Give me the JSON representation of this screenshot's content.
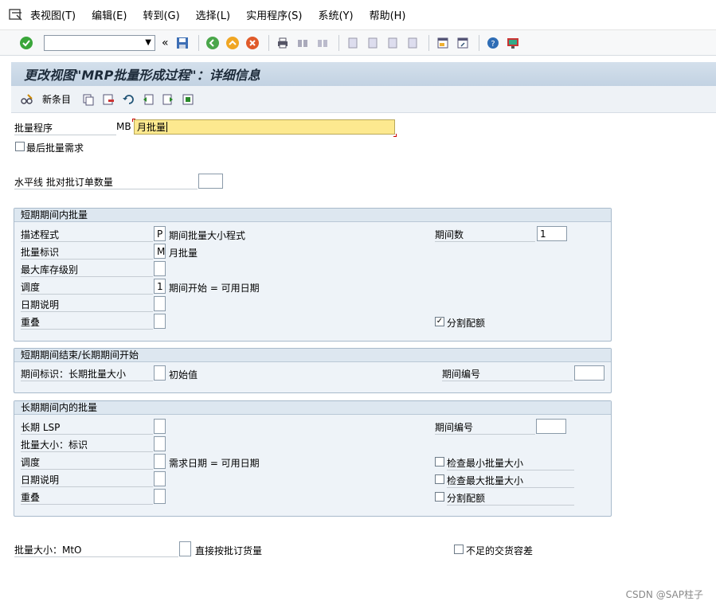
{
  "menubar": {
    "items": [
      "表视图(T)",
      "编辑(E)",
      "转到(G)",
      "选择(L)",
      "实用程序(S)",
      "系统(Y)",
      "帮助(H)"
    ]
  },
  "toolbar": {
    "cmd_chevron": "«"
  },
  "title": "更改视图\"MRP批量形成过程\"：详细信息",
  "apptoolbar": {
    "new_entry": "新条目"
  },
  "header": {
    "lot_proc_label": "批量程序",
    "lot_proc_code": "MB",
    "lot_proc_value": "月批量",
    "last_lot_label": "最后批量需求",
    "horizon_label": "水平线 批对批订单数量",
    "horizon_value": ""
  },
  "short_group": {
    "title": "短期期间内批量",
    "desc_label": "描述程式",
    "desc_code": "P",
    "desc_text": "期间批量大小程式",
    "periods_label": "期间数",
    "periods_value": "1",
    "lot_ind_label": "批量标识",
    "lot_ind_code": "M",
    "lot_ind_text": "月批量",
    "max_stock_label": "最大库存级别",
    "schedule_label": "调度",
    "schedule_code": "1",
    "schedule_text": "期间开始 = 可用日期",
    "date_spec_label": "日期说明",
    "overlap_label": "重叠",
    "split_quota_label": "分割配额"
  },
  "mid_group": {
    "title": "短期期间结束/长期期间开始",
    "period_ind_label": "期间标识：长期批量大小",
    "period_ind_text": "初始值",
    "period_num_label": "期间编号"
  },
  "long_group": {
    "title": "长期期间内的批量",
    "lsp_label": "长期 LSP",
    "period_num_label": "期间编号",
    "lot_size_label": "批量大小：标识",
    "schedule_label": "调度",
    "schedule_text": "需求日期 = 可用日期",
    "check_min_label": "检查最小批量大小",
    "date_spec_label": "日期说明",
    "check_max_label": "检查最大批量大小",
    "overlap_label": "重叠",
    "split_quota_label": "分割配额"
  },
  "bottom": {
    "mto_label": "批量大小：MtO",
    "direct_label": "直接按批订货量",
    "short_delivery_label": "不足的交货容差"
  },
  "watermark": "CSDN @SAP柱子",
  "colors": {
    "title_bg": "#c8d7e6",
    "group_bg": "#eef3f8",
    "highlight": "#fde98f",
    "ok_green": "#2f9a2f"
  }
}
